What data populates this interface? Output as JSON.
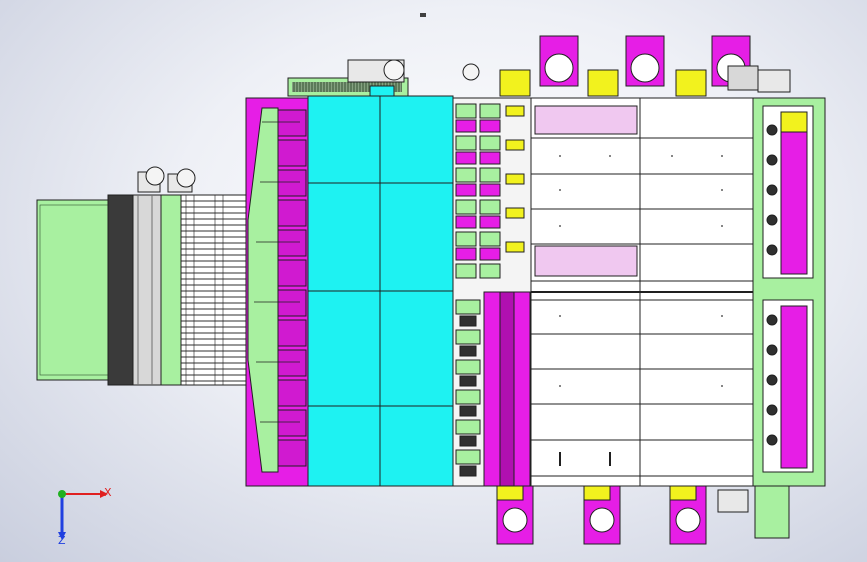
{
  "viewport": {
    "background": "#e6e9f2",
    "colors": {
      "cyan": "#1ef2f2",
      "magenta": "#e61ee6",
      "green": "#a8f0a0",
      "yellow": "#f2f21e",
      "panel": "#ffffff",
      "line": "#202020"
    }
  },
  "triad": {
    "x_label": "X",
    "z_label": "Z",
    "x_color": "#e02020",
    "y_color": "#20b020",
    "z_color": "#2040e0"
  }
}
